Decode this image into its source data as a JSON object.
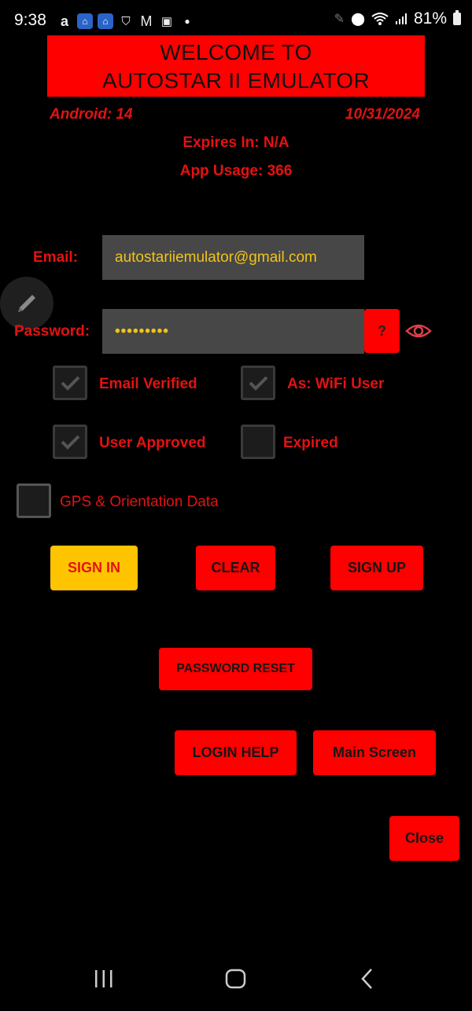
{
  "status_bar": {
    "time": "9:38",
    "left_icons": [
      "amazon-icon",
      "home-app-icon",
      "home-app-icon",
      "shield-app-icon",
      "gmail-icon",
      "calendar-icon",
      "dot-icon"
    ],
    "battery": "81%"
  },
  "banner": {
    "line1": "WELCOME TO",
    "line2": "AUTOSTAR II EMULATOR"
  },
  "info": {
    "android": "Android: 14",
    "date": "10/31/2024",
    "expires": "Expires In: N/A",
    "usage": "App Usage: 366"
  },
  "form": {
    "email_label": "Email:",
    "email_value": "autostariiemulator@gmail.com",
    "password_label": "Password:",
    "password_value": "•••••••••",
    "help_button": "?"
  },
  "checkboxes": [
    {
      "label": "Email Verified",
      "checked": true
    },
    {
      "label": "As: WiFi User",
      "checked": true
    },
    {
      "label": "User Approved",
      "checked": true
    },
    {
      "label": "Expired",
      "checked": false
    },
    {
      "label": "GPS & Orientation Data",
      "checked": false
    }
  ],
  "buttons": {
    "sign_in": "SIGN IN",
    "clear": "CLEAR",
    "sign_up": "SIGN UP",
    "password_reset": "PASSWORD RESET",
    "login_help": "LOGIN HELP",
    "main_screen": "Main Screen",
    "close": "Close"
  },
  "colors": {
    "accent_red": "#ff0000",
    "text_red": "#e31212",
    "field_text": "#f2c318",
    "sign_in_bg": "#ffc400"
  }
}
